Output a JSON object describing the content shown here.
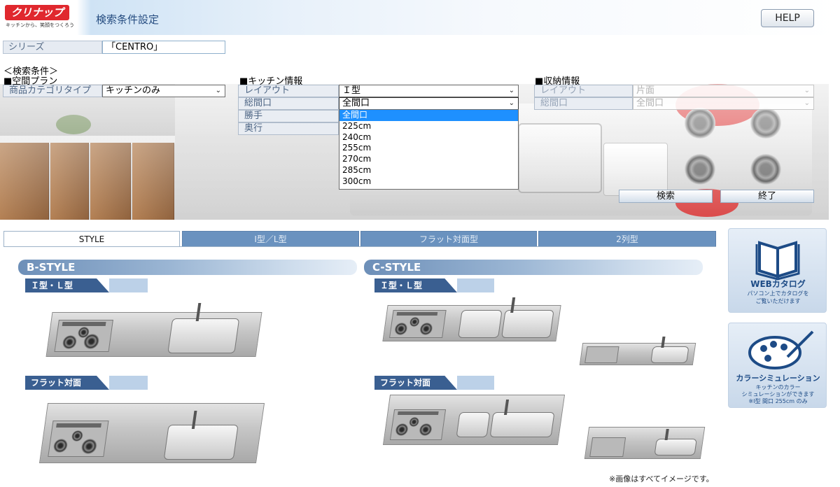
{
  "header": {
    "logo_text": "クリナップ",
    "logo_tagline": "キッチンから、笑顔をつくろう",
    "title": "検索条件設定",
    "help_label": "HELP"
  },
  "series": {
    "label": "シリーズ",
    "value": "「CENTRO」"
  },
  "conditions": {
    "heading": "＜検索条件＞",
    "space_plan": {
      "heading": "■空間プラン",
      "category_label": "商品カテゴリタイプ",
      "category_value": "キッチンのみ"
    },
    "kitchen": {
      "heading": "■キッチン情報",
      "layout_label": "レイアウト",
      "layout_value": "Ｉ型",
      "frontage_label": "総間口",
      "frontage_value": "全間口",
      "hand_label": "勝手",
      "depth_label": "奥行",
      "frontage_options": [
        "全間口",
        "225cm",
        "240cm",
        "255cm",
        "270cm",
        "285cm",
        "300cm"
      ],
      "selected_option": "全間口"
    },
    "storage": {
      "heading": "■収納情報",
      "layout_label": "レイアウト",
      "layout_value": "片面",
      "frontage_label": "総間口",
      "frontage_value": "全間口"
    },
    "search_label": "検索",
    "exit_label": "終了"
  },
  "tabs": [
    {
      "label": "STYLE",
      "active": true
    },
    {
      "label": "I型／L型",
      "active": false
    },
    {
      "label": "フラット対面型",
      "active": false
    },
    {
      "label": "2列型",
      "active": false
    }
  ],
  "styles": {
    "b": {
      "title": "B-STYLE",
      "sub1": "Ｉ型・Ｌ型",
      "sub2": "フラット対面"
    },
    "c": {
      "title": "C-STYLE",
      "sub1": "Ｉ型・Ｌ型",
      "sub2": "フラット対面"
    }
  },
  "side": {
    "catalog_title": "WEBカタログ",
    "catalog_sub1": "パソコン上でカタログを",
    "catalog_sub2": "ご覧いただけます",
    "color_title": "カラーシミュレーション",
    "color_sub1": "キッチンのカラー",
    "color_sub2": "シミュレーションができます",
    "color_sub3": "※I型 間口 255cm のみ"
  },
  "note": "※画像はすべてイメージです。",
  "colors": {
    "accent": "#3a5f91",
    "tab_inactive": "#6a92bf",
    "dropdown_highlight": "#1e90ff",
    "logo_red": "#e0282e"
  }
}
